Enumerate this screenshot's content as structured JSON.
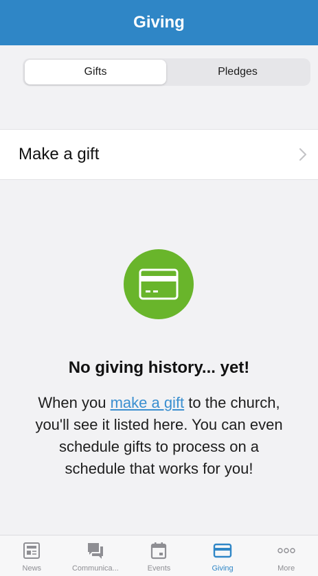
{
  "header": {
    "title": "Giving"
  },
  "segments": {
    "gifts": "Gifts",
    "pledges": "Pledges",
    "active": "gifts"
  },
  "list": {
    "make_gift_label": "Make a gift",
    "chevron_icon": "chevron-right-icon"
  },
  "empty_state": {
    "icon": "credit-card-icon",
    "title": "No giving history... yet!",
    "text_before": "When you ",
    "link_text": "make a gift",
    "text_after": " to the church, you'll see it listed here. You can even schedule gifts to process on a schedule that works for you!"
  },
  "tabs": [
    {
      "label": "News",
      "icon": "news-icon"
    },
    {
      "label": "Communica...",
      "icon": "chat-icon"
    },
    {
      "label": "Events",
      "icon": "calendar-icon"
    },
    {
      "label": "Giving",
      "icon": "card-icon",
      "active": true
    },
    {
      "label": "More",
      "icon": "more-dots-icon"
    }
  ],
  "colors": {
    "header": "#2f86c6",
    "accent_green": "#69b52b",
    "link": "#3a8fd0",
    "tab_active": "#2f86c6",
    "tab_inactive": "#8e8e93"
  }
}
